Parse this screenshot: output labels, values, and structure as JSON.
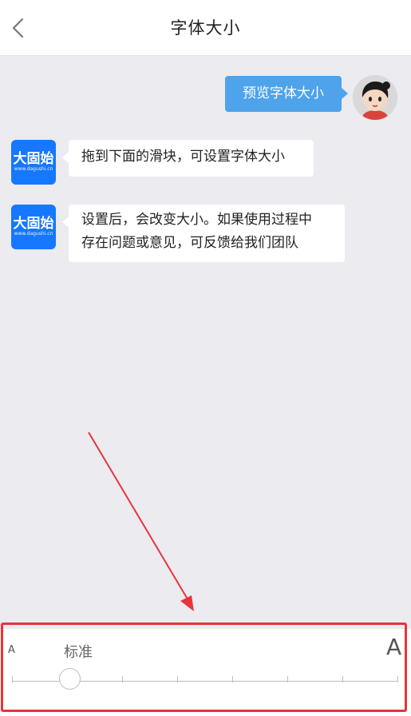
{
  "header": {
    "title": "字体大小"
  },
  "messages": {
    "preview": "预览字体大小",
    "drag_tip": "拖到下面的滑块，可设置字体大小",
    "after_line1": "设置后，会改变大小。如果使用过程中",
    "after_line2": "存在问题或意见，可反馈给我们团队"
  },
  "logo": {
    "name": "大固始",
    "url": "www.dagushi.cn"
  },
  "font_size_slider": {
    "small_label": "A",
    "large_label": "A",
    "current_label": "标准",
    "steps": 8,
    "selected_index": 1
  },
  "colors": {
    "accent_blue": "#4ea3ea",
    "logo_blue": "#1677ff",
    "annotation_red": "#e7343a"
  }
}
